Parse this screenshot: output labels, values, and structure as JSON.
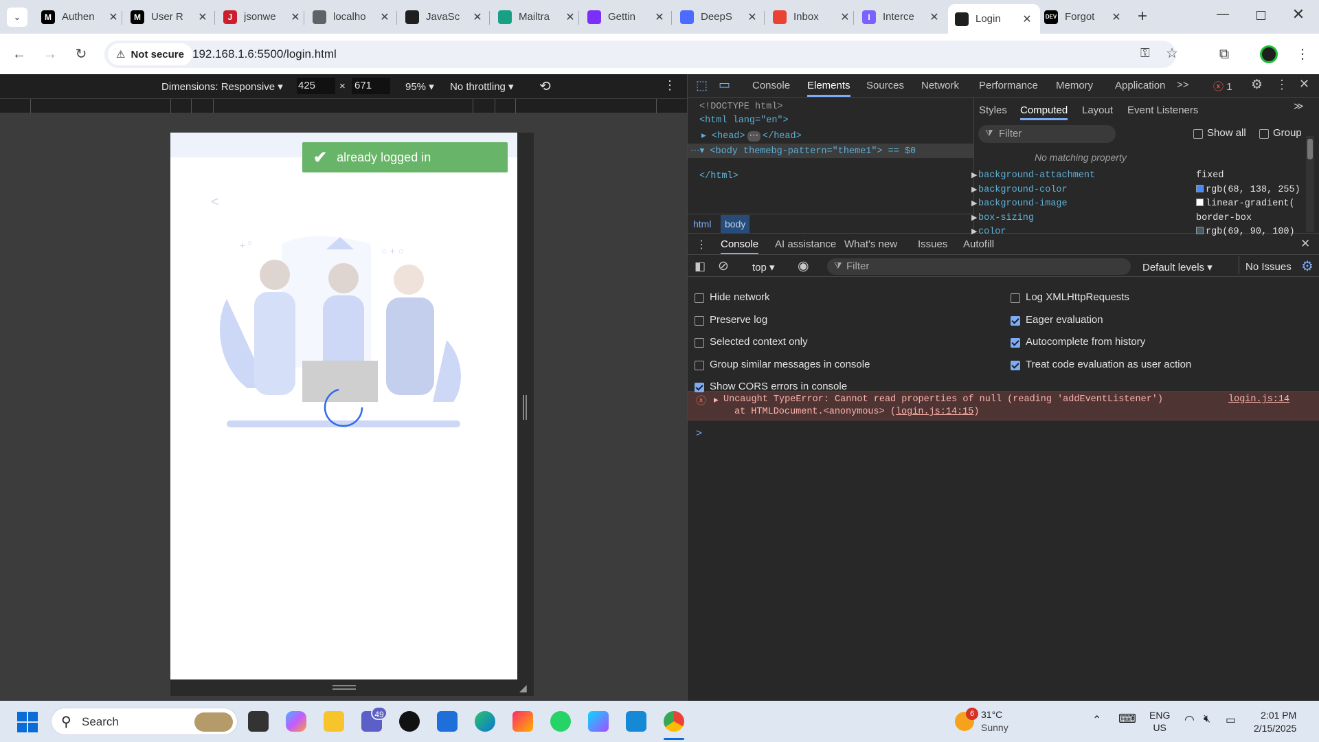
{
  "tabs": [
    {
      "title": "Authen",
      "favicon": "M",
      "color": "#000000"
    },
    {
      "title": "User R",
      "favicon": "M",
      "color": "#000000"
    },
    {
      "title": "jsonwe",
      "favicon": "J",
      "color": "#cc1f2e"
    },
    {
      "title": "localho",
      "favicon": "globe",
      "color": "#5f6368"
    },
    {
      "title": "JavaSc",
      "favicon": "chatgpt",
      "color": "#1f1f1f"
    },
    {
      "title": "Mailtra",
      "favicon": "mail",
      "color": "#18a085"
    },
    {
      "title": "Gettin",
      "favicon": "check",
      "color": "#7b2ff7"
    },
    {
      "title": "DeepS",
      "favicon": "whale",
      "color": "#4d6bfe"
    },
    {
      "title": "Inbox",
      "favicon": "gmail",
      "color": "#ea4335"
    },
    {
      "title": "Interce",
      "favicon": "I",
      "color": "#7b61ff"
    },
    {
      "title": "Login",
      "favicon": "caret",
      "color": "#1f1f1f"
    },
    {
      "title": "Forgot",
      "favicon": "DEV",
      "color": "#000000"
    }
  ],
  "address": {
    "security": "Not secure",
    "url": "192.168.1.6:5500/login.html"
  },
  "device_toolbar": {
    "dimensions": "Dimensions: Responsive",
    "width": "425",
    "height": "671",
    "times": "×",
    "zoom": "95%",
    "throttling": "No throttling"
  },
  "page": {
    "toast": "already logged in",
    "back_glyph": "<"
  },
  "devtools": {
    "tabs": [
      "Console",
      "Elements",
      "Sources",
      "Network",
      "Performance",
      "Memory",
      "Application"
    ],
    "more": ">>",
    "error_count": "1",
    "elements": [
      "<!DOCTYPE html>",
      "<html lang=\"en\">",
      "<head>",
      "</head>",
      "<body themebg-pattern=\"theme1\"> == $0",
      "</html>"
    ],
    "breadcrumbs": [
      "html",
      "body"
    ],
    "styles_tabs": [
      "Styles",
      "Computed",
      "Layout",
      "Event Listeners"
    ],
    "filter_placeholder": "Filter",
    "show_all": "Show all",
    "group": "Group",
    "no_matching": "No matching property",
    "computed": [
      {
        "prop": "background-attachment",
        "value": "fixed"
      },
      {
        "prop": "background-color",
        "value": "rgb(68, 138, 255)",
        "swatch": "#448aff"
      },
      {
        "prop": "background-image",
        "value": "linear-gradient(",
        "swatch": "#ffffff"
      },
      {
        "prop": "box-sizing",
        "value": "border-box"
      },
      {
        "prop": "color",
        "value": "rgb(69, 90, 100)",
        "swatch": "#455a64"
      }
    ],
    "drawer_tabs": [
      "Console",
      "AI assistance",
      "What's new",
      "Issues",
      "Autofill"
    ],
    "console_context": "top",
    "console_filter": "Filter",
    "default_levels": "Default levels",
    "no_issues": "No Issues",
    "settings_left": [
      {
        "label": "Hide network",
        "checked": false
      },
      {
        "label": "Preserve log",
        "checked": false
      },
      {
        "label": "Selected context only",
        "checked": false
      },
      {
        "label": "Group similar messages in console",
        "checked": false
      },
      {
        "label": "Show CORS errors in console",
        "checked": true
      }
    ],
    "settings_right": [
      {
        "label": "Log XMLHttpRequests",
        "checked": false
      },
      {
        "label": "Eager evaluation",
        "checked": true
      },
      {
        "label": "Autocomplete from history",
        "checked": true
      },
      {
        "label": "Treat code evaluation as user action",
        "checked": true
      }
    ],
    "error": {
      "message": "Uncaught TypeError: Cannot read properties of null (reading 'addEventListener')",
      "stack_prefix": "at HTMLDocument.<anonymous> (",
      "stack_link": "login.js:14:15",
      "stack_suffix": ")",
      "source": "login.js:14"
    },
    "prompt": ">"
  },
  "taskbar": {
    "search": "Search",
    "teams_badge": "49",
    "weather_badge": "6",
    "temperature": "31°C",
    "condition": "Sunny",
    "lang": "ENG",
    "region": "US",
    "time": "2:01 PM",
    "date": "2/15/2025"
  }
}
